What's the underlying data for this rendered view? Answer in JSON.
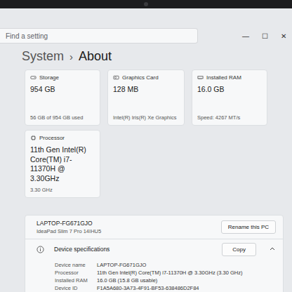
{
  "window": {
    "controls": [
      "—",
      "☐",
      "✕"
    ]
  },
  "search": {
    "placeholder": "Find a setting"
  },
  "breadcrumb": {
    "parent": "System",
    "separator": "›",
    "current": "About"
  },
  "cards": [
    {
      "kind": "storage",
      "label": "Storage",
      "value": "954 GB",
      "detail": "56 GB of 954 GB used"
    },
    {
      "kind": "graphics",
      "label": "Graphics Card",
      "value": "128 MB",
      "detail": "Intel(R) Iris(R) Xe Graphics"
    },
    {
      "kind": "ram",
      "label": "Installed RAM",
      "value": "16.0 GB",
      "detail": "Speed: 4267 MT/s"
    },
    {
      "kind": "processor",
      "label": "Processor",
      "value": "11th Gen Intel(R) Core(TM) i7-11370H @ 3.30GHz",
      "detail": "3.30 GHz"
    }
  ],
  "device": {
    "name": "LAPTOP-FG671GJO",
    "model": "IdeaPad Slim 7 Pro 14IHU5",
    "rename_button": "Rename this PC"
  },
  "specifications": {
    "title": "Device specifications",
    "copy_button": "Copy",
    "expanded": true,
    "rows": [
      {
        "label": "Device name",
        "value": "LAPTOP-FG671GJO"
      },
      {
        "label": "Processor",
        "value": "11th Gen Intel(R) Core(TM) i7-11370H @ 3.30GHz (3.30 GHz)"
      },
      {
        "label": "Installed RAM",
        "value": "16.0 GB (15.8 GB usable)"
      },
      {
        "label": "Device ID",
        "value": "F1A5A680-3A73-4F91-BF53-638486D2F84"
      }
    ]
  }
}
